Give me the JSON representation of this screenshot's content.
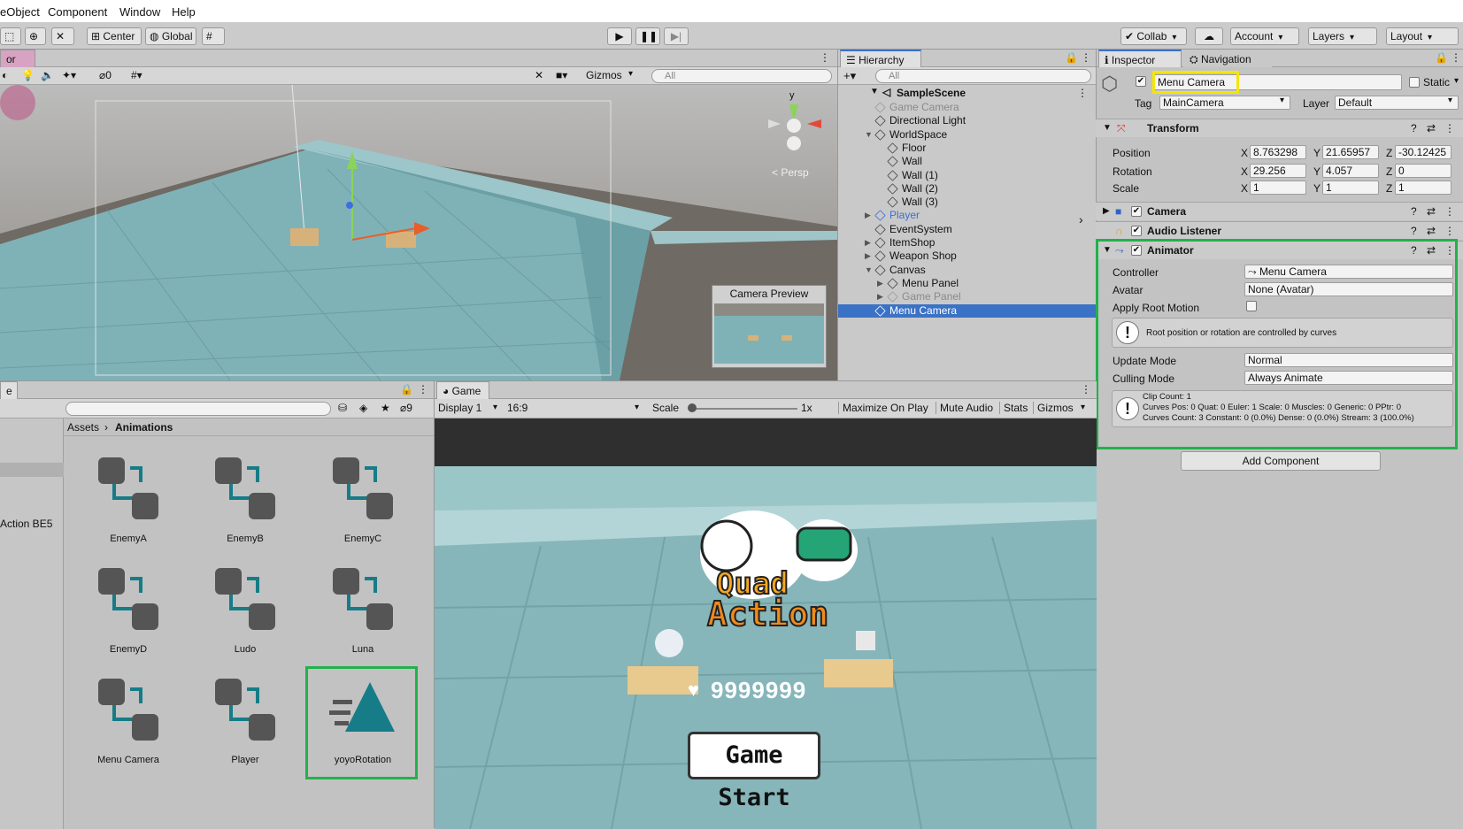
{
  "menubar": {
    "items": [
      "eObject",
      "Component",
      "Window",
      "Help"
    ]
  },
  "toolbar": {
    "center_label": "Center",
    "global_label": "Global",
    "collab_label": "Collab",
    "account_label": "Account",
    "layers_label": "Layers",
    "layout_label": "Layout"
  },
  "scene": {
    "tab_label": "or",
    "gizmos_label": "Gizmos",
    "search_placeholder": "All",
    "hidden_count": "0",
    "gizmo_axis_label": "y",
    "persp_label": "< Persp",
    "camera_preview_title": "Camera Preview"
  },
  "hierarchy": {
    "tab_label": "Hierarchy",
    "search_placeholder": "All",
    "scene_name": "SampleScene",
    "items": [
      {
        "label": "Game Camera",
        "depth": 1,
        "arrow": "",
        "disabled": true,
        "prefab": false,
        "selected": false
      },
      {
        "label": "Directional Light",
        "depth": 1,
        "arrow": "",
        "disabled": false,
        "prefab": false,
        "selected": false
      },
      {
        "label": "WorldSpace",
        "depth": 1,
        "arrow": "▼",
        "disabled": false,
        "prefab": false,
        "selected": false
      },
      {
        "label": "Floor",
        "depth": 2,
        "arrow": "",
        "disabled": false,
        "prefab": false,
        "selected": false
      },
      {
        "label": "Wall",
        "depth": 2,
        "arrow": "",
        "disabled": false,
        "prefab": false,
        "selected": false
      },
      {
        "label": "Wall (1)",
        "depth": 2,
        "arrow": "",
        "disabled": false,
        "prefab": false,
        "selected": false
      },
      {
        "label": "Wall (2)",
        "depth": 2,
        "arrow": "",
        "disabled": false,
        "prefab": false,
        "selected": false
      },
      {
        "label": "Wall (3)",
        "depth": 2,
        "arrow": "",
        "disabled": false,
        "prefab": false,
        "selected": false
      },
      {
        "label": "Player",
        "depth": 1,
        "arrow": "▶",
        "disabled": false,
        "prefab": true,
        "selected": false
      },
      {
        "label": "EventSystem",
        "depth": 1,
        "arrow": "",
        "disabled": false,
        "prefab": false,
        "selected": false
      },
      {
        "label": "ItemShop",
        "depth": 1,
        "arrow": "▶",
        "disabled": false,
        "prefab": false,
        "selected": false
      },
      {
        "label": "Weapon Shop",
        "depth": 1,
        "arrow": "▶",
        "disabled": false,
        "prefab": false,
        "selected": false
      },
      {
        "label": "Canvas",
        "depth": 1,
        "arrow": "▼",
        "disabled": false,
        "prefab": false,
        "selected": false
      },
      {
        "label": "Menu Panel",
        "depth": 2,
        "arrow": "▶",
        "disabled": false,
        "prefab": false,
        "selected": false
      },
      {
        "label": "Game Panel",
        "depth": 2,
        "arrow": "▶",
        "disabled": true,
        "prefab": false,
        "selected": false
      },
      {
        "label": "Menu Camera",
        "depth": 1,
        "arrow": "",
        "disabled": false,
        "prefab": false,
        "selected": true
      }
    ]
  },
  "inspector": {
    "tab_label": "Inspector",
    "nav_tab_label": "Navigation",
    "object_name": "Menu Camera",
    "static_label": "Static",
    "tag_label": "Tag",
    "tag_value": "MainCamera",
    "layer_label": "Layer",
    "layer_value": "Default",
    "transform": {
      "title": "Transform",
      "rows": [
        {
          "label": "Position",
          "x": "8.763298",
          "y": "21.65957",
          "z": "-30.12425"
        },
        {
          "label": "Rotation",
          "x": "29.256",
          "y": "4.057",
          "z": "0"
        },
        {
          "label": "Scale",
          "x": "1",
          "y": "1",
          "z": "1"
        }
      ]
    },
    "camera_title": "Camera",
    "audio_title": "Audio Listener",
    "animator": {
      "title": "Animator",
      "controller_label": "Controller",
      "controller_value": "Menu Camera",
      "avatar_label": "Avatar",
      "avatar_value": "None (Avatar)",
      "root_motion_label": "Apply Root Motion",
      "info_root": "Root position or rotation are controlled by curves",
      "update_mode_label": "Update Mode",
      "update_mode_value": "Normal",
      "culling_label": "Culling Mode",
      "culling_value": "Always Animate",
      "clip_info_1": "Clip Count: 1",
      "clip_info_2": "Curves Pos: 0 Quat: 0 Euler: 1 Scale: 0 Muscles: 0 Generic: 0 PPtr: 0",
      "clip_info_3": "Curves Count: 3 Constant: 0 (0.0%) Dense: 0 (0.0%) Stream: 3 (100.0%)"
    },
    "add_component_label": "Add Component"
  },
  "project": {
    "tab_label": "e",
    "hidden_count": "9",
    "breadcrumb_root": "Assets",
    "breadcrumb_current": "Animations",
    "left_item": "Action BE5",
    "assets": [
      {
        "label": "EnemyA",
        "kind": "controller"
      },
      {
        "label": "EnemyB",
        "kind": "controller"
      },
      {
        "label": "EnemyC",
        "kind": "controller"
      },
      {
        "label": "EnemyD",
        "kind": "controller"
      },
      {
        "label": "Ludo",
        "kind": "controller"
      },
      {
        "label": "Luna",
        "kind": "controller"
      },
      {
        "label": "Menu Camera",
        "kind": "controller"
      },
      {
        "label": "Player",
        "kind": "controller"
      },
      {
        "label": "yoyoRotation",
        "kind": "clip"
      }
    ]
  },
  "game": {
    "tab_label": "Game",
    "display_label": "Display 1",
    "aspect_label": "16:9",
    "scale_label": "Scale",
    "scale_value": "1x",
    "scale_level": 0,
    "maximize_label": "Maximize On Play",
    "mute_label": "Mute Audio",
    "stats_label": "Stats",
    "gizmos_label": "Gizmos",
    "logo_line1": "Quad",
    "logo_line2": "Action",
    "score": "9999999",
    "start_button": "Game Start"
  },
  "colors": {
    "highlight_yellow": "#f5e600",
    "highlight_green": "#22b14c",
    "selection_blue": "#3a72c6",
    "prefab_blue": "#3b6fd0",
    "anim_teal": "#167c87"
  }
}
